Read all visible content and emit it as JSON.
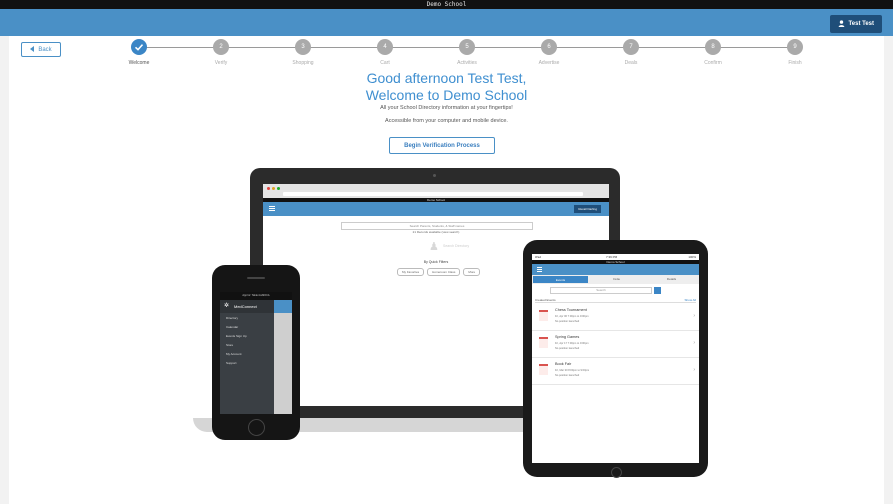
{
  "window": {
    "title": "Demo School"
  },
  "header": {
    "user_label": "Test Test"
  },
  "nav": {
    "back_label": "Back"
  },
  "steps": [
    {
      "label": "Welcome",
      "num": ""
    },
    {
      "label": "Verify",
      "num": "2"
    },
    {
      "label": "Shopping",
      "num": "3"
    },
    {
      "label": "Cart",
      "num": "4"
    },
    {
      "label": "Activities",
      "num": "5"
    },
    {
      "label": "Advertise",
      "num": "6"
    },
    {
      "label": "Deals",
      "num": "7"
    },
    {
      "label": "Confirm",
      "num": "8"
    },
    {
      "label": "Finish",
      "num": "9"
    }
  ],
  "welcome": {
    "greeting_line1": "Good afternoon Test Test,",
    "greeting_line2": "Welcome to Demo School",
    "tagline1": "All your School Directory information at your fingertips!",
    "tagline2": "Accessible from your computer and mobile device.",
    "begin_label": "Begin Verification Process"
  },
  "laptop": {
    "app_title": "Demo School",
    "search_placeholder": "Search Parents, Students, & Staff names",
    "records_text": "21 Records available (view search)",
    "search_heading": "Search Directory",
    "quick_filters_title": "By Quick Filters",
    "filters": [
      "My Favorites",
      "Homeroom Class",
      "More"
    ],
    "user_label": "Recall Darling"
  },
  "tablet": {
    "app_title": "Demo School",
    "time": "7:39 PM",
    "carrier": "iPad",
    "battery": "100%",
    "tabs": [
      "Events",
      "Invite",
      "Details"
    ],
    "search_placeholder": "Search",
    "section_title": "Created Events",
    "section_link": "Show All",
    "events": [
      {
        "title": "Chess Tournament",
        "line1": "Fri, Apr 06 7:00pm to 9:00pm",
        "line2": "No position launched"
      },
      {
        "title": "Spring Games",
        "line1": "Fri, Apr 17 7:00pm to 9:00pm",
        "line2": "No position launched"
      },
      {
        "title": "Book Fair",
        "line1": "Fri, Mar 30 8:00pm to 9:00pm",
        "line2": "No position launched"
      }
    ]
  },
  "phone": {
    "status": "App for: Tablet ALMOCA",
    "brand": "MedConnect",
    "menu": [
      "Directory",
      "Calendar",
      "Events Sign Up",
      "Store",
      "My Account",
      "Support"
    ]
  }
}
